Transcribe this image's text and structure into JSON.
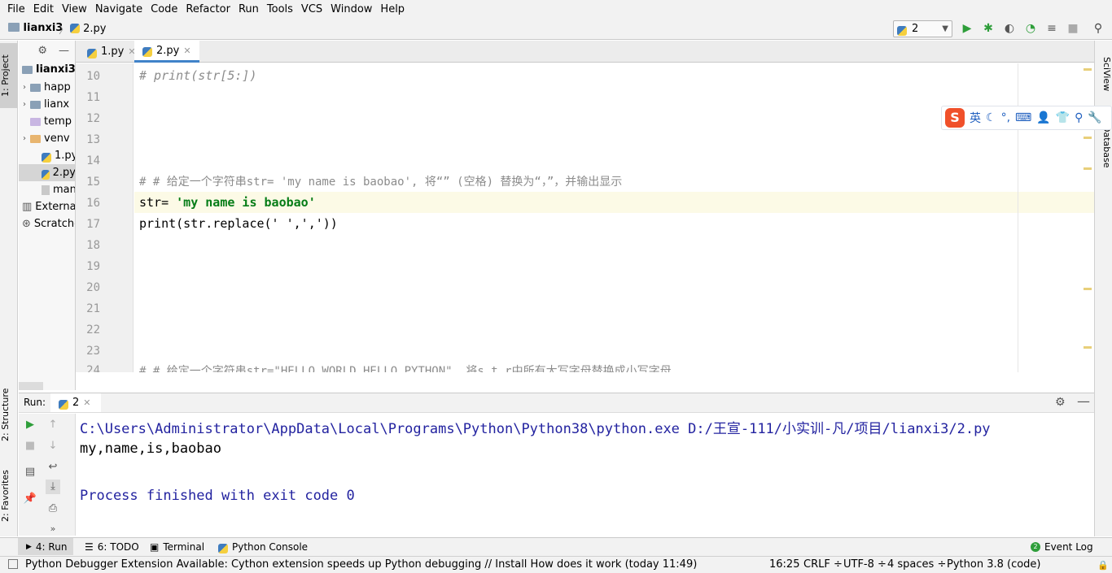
{
  "menu": [
    "File",
    "Edit",
    "View",
    "Navigate",
    "Code",
    "Refactor",
    "Run",
    "Tools",
    "VCS",
    "Window",
    "Help"
  ],
  "breadcrumb": {
    "project": "lianxi3",
    "file": "2.py"
  },
  "run_config": {
    "name": "2"
  },
  "left_tabs": {
    "project": "1: Project",
    "structure": "2: Structure",
    "favorites": "2: Favorites"
  },
  "right_tabs": {
    "sciview": "SciView",
    "database": "Database"
  },
  "project_tree": {
    "root": "lianxi3",
    "items": [
      "happ",
      "lianx",
      "temp",
      "venv",
      "1.py",
      "2.py",
      "man",
      "External",
      "Scratche"
    ]
  },
  "editor_tabs": [
    {
      "label": "1.py"
    },
    {
      "label": "2.py"
    }
  ],
  "line_numbers": [
    "10",
    "11",
    "12",
    "13",
    "14",
    "15",
    "16",
    "17",
    "18",
    "19",
    "20",
    "21",
    "22",
    "23",
    "24"
  ],
  "code": {
    "l10": "# print(str[5:])",
    "l15": "# # 给定一个字符串str= 'my name is baobao', 将“” (空格) 替换为“，”，并输出显示",
    "l16_a": "str= ",
    "l16_b": "'my name is baobao'",
    "l17": "print(str.replace(' ',','))",
    "l24": "# # 给定一个字符串str=\"HELLO WORLD HELLO PYTHON\", 将s t r中所有大写字母替换成小写字母"
  },
  "ime": {
    "logo": "S",
    "lang": "英"
  },
  "run_panel": {
    "label": "Run:",
    "tab": "2",
    "output": [
      "C:\\Users\\Administrator\\AppData\\Local\\Programs\\Python\\Python38\\python.exe D:/王宣-111/小实训-凡/项目/lianxi3/2.py",
      "my,name,is,baobao",
      "",
      "Process finished with exit code 0"
    ]
  },
  "bottom_tabs": {
    "run": "4: Run",
    "todo": "6: TODO",
    "terminal": "Terminal",
    "python_console": "Python Console",
    "event_log": "Event Log",
    "event_count": "2"
  },
  "status": {
    "message": "Python Debugger Extension Available: Cython extension speeds up Python debugging // Install How does it work (today 11:49)",
    "position": "16:25",
    "line_sep": "CRLF ÷",
    "encoding": "UTF-8 ÷",
    "indent": "4 spaces ÷",
    "interpreter": "Python 3.8 (code)"
  },
  "colors": {
    "accent": "#4083c9",
    "string": "#067d17",
    "comment": "#8c8c8c",
    "console_blue": "#2323a0",
    "run_green": "#2e9e3a"
  }
}
